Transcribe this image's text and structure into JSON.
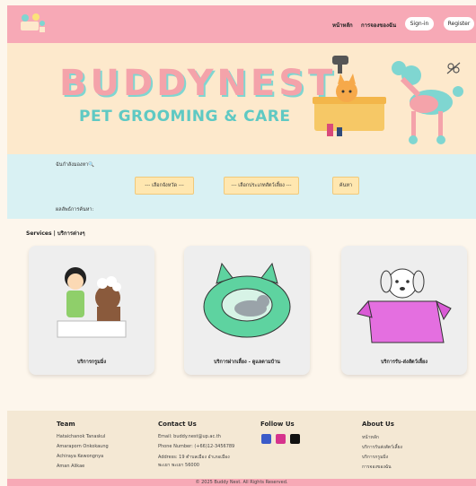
{
  "header": {
    "nav": [
      "หน้าหลัก",
      "การจองของฉัน"
    ],
    "signin_label": "Sign-in",
    "register_label": "Register"
  },
  "banner": {
    "brand": "BUDDYNEST",
    "tagline": "PET GROOMING & CARE"
  },
  "search": {
    "title": "ฉันกำลังมองหา🔍",
    "province_select": "--- เลือกจังหวัด ---",
    "pet_type_select": "--- เลือกประเภทสัตว์เลี้ยง ---",
    "search_button": "ค้นหา",
    "results_label": "ผลลัพธ์การค้นหา:"
  },
  "services": {
    "title": "Services | บริการต่างๆ",
    "cards": [
      {
        "label": "บริการกรูมมิ่ง",
        "icon": "grooming-illustration"
      },
      {
        "label": "บริการฝากเลี้ยง - ดูแลตามบ้าน",
        "icon": "cat-bed-illustration"
      },
      {
        "label": "บริการรับ-ส่งสัตว์เลี้ยง",
        "icon": "dog-box-illustration"
      }
    ]
  },
  "footer": {
    "team": {
      "title": "Team",
      "members": [
        "Hataichanok Tanaskul",
        "Amaraporn Onkokaung",
        "Achiraya Kewongnya",
        "Aman Alikae"
      ]
    },
    "contact": {
      "title": "Contact Us",
      "lines": [
        "Email: buddy.nest@up.ac.th",
        "Phone Number: (+66)12-3456789",
        "Address: 19 ตำบลเมือง อำเภอเมือง",
        "พะเยา พะเยา 56000"
      ]
    },
    "follow": {
      "title": "Follow Us",
      "icons": [
        "facebook-icon",
        "instagram-icon",
        "x-icon"
      ]
    },
    "about": {
      "title": "About Us",
      "links": [
        "หน้าหลัก",
        "บริการรับส่งสัตว์เลี้ยง",
        "บริการกรูมมิ่ง",
        "การจองของฉัน"
      ]
    },
    "copyright": "© 2025 Buddy Nest. All Rights Reserved."
  },
  "colors": {
    "header_pink": "#f7a9b6",
    "banner_cream": "#fde9cc",
    "search_mint": "#d9f1f3",
    "brand_pink": "#f4a3aa",
    "brand_teal": "#5fc9c3"
  }
}
